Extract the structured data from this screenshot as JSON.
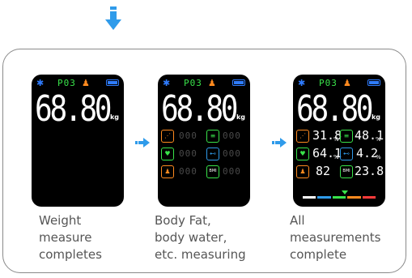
{
  "colors": {
    "accent_blue": "#2f9bea",
    "screen_bg": "#000000"
  },
  "screens": [
    {
      "pcode": "P03",
      "weight": "68.80",
      "unit": "kg",
      "rows": []
    },
    {
      "pcode": "P03",
      "weight": "68.80",
      "unit": "kg",
      "rows": [
        {
          "left": {
            "icon": "body-fat-icon",
            "color": "#ff8a1f",
            "value": "000"
          },
          "right": {
            "icon": "body-water-icon",
            "color": "#39e34a",
            "value": "000"
          }
        },
        {
          "left": {
            "icon": "muscle-icon",
            "color": "#39e34a",
            "value": "000"
          },
          "right": {
            "icon": "bone-icon",
            "color": "#2f9bea",
            "value": "000"
          }
        },
        {
          "left": {
            "icon": "person-icon",
            "color": "#ff8a1f",
            "value": "000"
          },
          "right": {
            "icon": "bmi-icon",
            "color": "#39e34a",
            "value": "000"
          }
        }
      ]
    },
    {
      "pcode": "P03",
      "weight": "68.80",
      "unit": "kg",
      "rows": [
        {
          "left": {
            "icon": "body-fat-icon",
            "color": "#ff8a1f",
            "value": "31.8",
            "unit": "%"
          },
          "right": {
            "icon": "body-water-icon",
            "color": "#39e34a",
            "value": "48.1",
            "unit": "%"
          }
        },
        {
          "left": {
            "icon": "muscle-icon",
            "color": "#39e34a",
            "value": "64.1",
            "unit": "%"
          },
          "right": {
            "icon": "bone-icon",
            "color": "#2f9bea",
            "value": "4.2",
            "unit": "%"
          }
        },
        {
          "left": {
            "icon": "person-icon",
            "color": "#ff8a1f",
            "value": "82"
          },
          "right": {
            "icon": "bmi-icon",
            "color": "#39e34a",
            "value": "23.8"
          }
        }
      ],
      "range_bar_colors": [
        "#ffffff",
        "#2f9bea",
        "#39e34a",
        "#ff8a1f",
        "#ff3b3b"
      ]
    }
  ],
  "captions": [
    [
      "Weight",
      "measure",
      "completes"
    ],
    [
      "Body Fat,",
      "body water,",
      "etc. measuring"
    ],
    [
      "All",
      "measurements",
      "complete"
    ]
  ],
  "icon_text": {
    "bmi": "BMI"
  }
}
